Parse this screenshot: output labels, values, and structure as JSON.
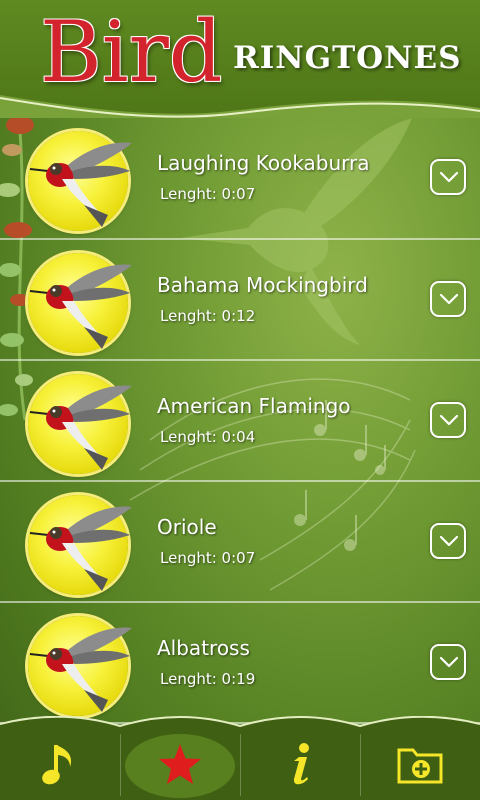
{
  "header": {
    "brand_main": "Bird",
    "brand_sub": "RINGTONES"
  },
  "colors": {
    "brand_red": "#d3232c",
    "avatar_yellow": "#f7f13a",
    "accent_star": "#e01d1d",
    "tab_icon_yellow": "#f5e62a"
  },
  "ringtones": [
    {
      "title": "Laughing Kookaburra",
      "length": "Lenght: 0:07"
    },
    {
      "title": "Bahama Mockingbird",
      "length": "Lenght: 0:12"
    },
    {
      "title": "American Flamingo",
      "length": "Lenght: 0:04"
    },
    {
      "title": "Oriole",
      "length": "Lenght: 0:07"
    },
    {
      "title": "Albatross",
      "length": "Lenght: 0:19"
    }
  ],
  "bottom_nav": [
    {
      "icon": "music-note-icon",
      "active": false
    },
    {
      "icon": "star-icon",
      "active": true
    },
    {
      "icon": "info-icon",
      "active": false
    },
    {
      "icon": "folder-add-icon",
      "active": false
    }
  ]
}
